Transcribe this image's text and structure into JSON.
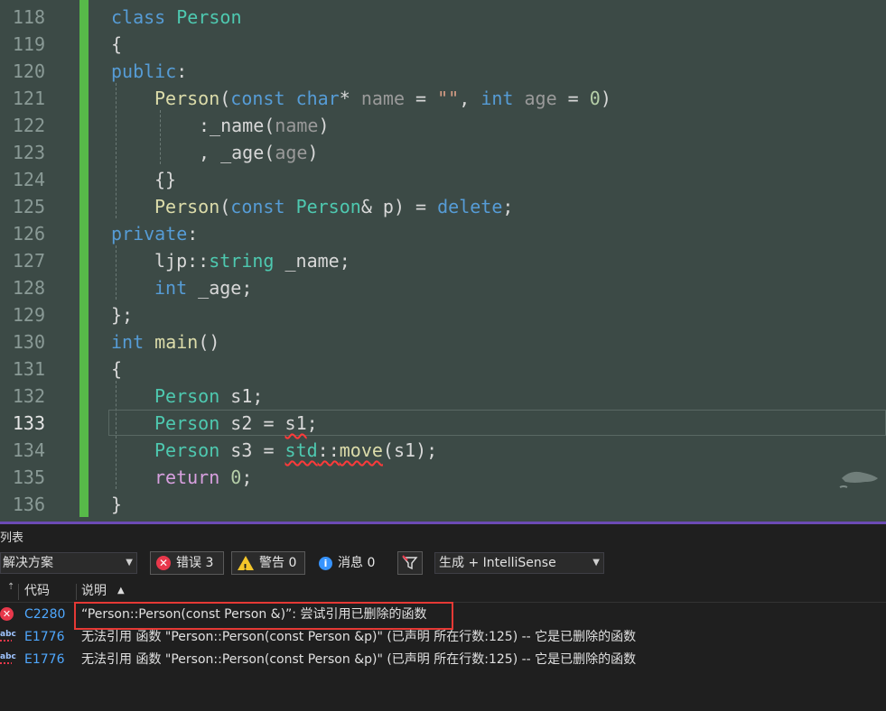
{
  "editor": {
    "line_numbers": [
      "118",
      "119",
      "120",
      "121",
      "122",
      "123",
      "124",
      "125",
      "126",
      "127",
      "128",
      "129",
      "130",
      "131",
      "132",
      "133",
      "134",
      "135",
      "136"
    ],
    "active_line": "133",
    "tokens": {
      "l118": [
        "class",
        "Person"
      ],
      "l119": [
        "{"
      ],
      "l120": [
        "public",
        ":"
      ],
      "l121": [
        "Person",
        "(",
        "const",
        "char",
        "*",
        "name",
        "=",
        "\"\"",
        ",",
        "int",
        "age",
        "=",
        "0",
        ")"
      ],
      "l122": [
        ":_name",
        "(",
        "name",
        ")"
      ],
      "l123": [
        ",",
        "_age",
        "(",
        "age",
        ")"
      ],
      "l124": [
        "{}"
      ],
      "l125": [
        "Person",
        "(",
        "const",
        "Person",
        "&",
        "p",
        ")",
        "=",
        "delete",
        ";"
      ],
      "l126": [
        "private",
        ":"
      ],
      "l127": [
        "ljp",
        "::",
        "string",
        "_name",
        ";"
      ],
      "l128": [
        "int",
        "_age",
        ";"
      ],
      "l129": [
        "};"
      ],
      "l130": [
        "int",
        "main",
        "()"
      ],
      "l131": [
        "{"
      ],
      "l132": [
        "Person",
        "s1",
        ";"
      ],
      "l133": [
        "Person",
        "s2",
        "=",
        "s1",
        ";"
      ],
      "l134": [
        "Person",
        "s3",
        "=",
        "std",
        "::",
        "move",
        "(",
        "s1",
        ");"
      ],
      "l135": [
        "return",
        "0",
        ";"
      ],
      "l136": [
        "}"
      ]
    }
  },
  "error_list": {
    "title": "列表",
    "scope_combo": "解决方案",
    "errors_label": "错误 3",
    "warnings_label": "警告 0",
    "messages_label": "消息 0",
    "build_combo": "生成 + IntelliSense",
    "col_code": "代码",
    "col_desc": "说明",
    "rows": [
      {
        "code": "C2280",
        "desc": "“Person::Person(const Person &)”: 尝试引用已删除的函数",
        "icon": "error-icon"
      },
      {
        "code": "E1776",
        "desc": "无法引用 函数 \"Person::Person(const Person &p)\" (已声明 所在行数:125) -- 它是已删除的函数",
        "icon": "intellisense-error-icon"
      },
      {
        "code": "E1776",
        "desc": "无法引用 函数 \"Person::Person(const Person &p)\" (已声明 所在行数:125) -- 它是已删除的函数",
        "icon": "intellisense-error-icon"
      }
    ]
  },
  "colors": {
    "editor_bg": "#3c4a46",
    "change_bar": "#57b949",
    "keyword": "#569cd6",
    "type": "#4ec9b0",
    "function": "#dcdcaa",
    "control": "#d8a0df",
    "error": "#e8384b",
    "panel_separator": "#6c4bb5"
  }
}
